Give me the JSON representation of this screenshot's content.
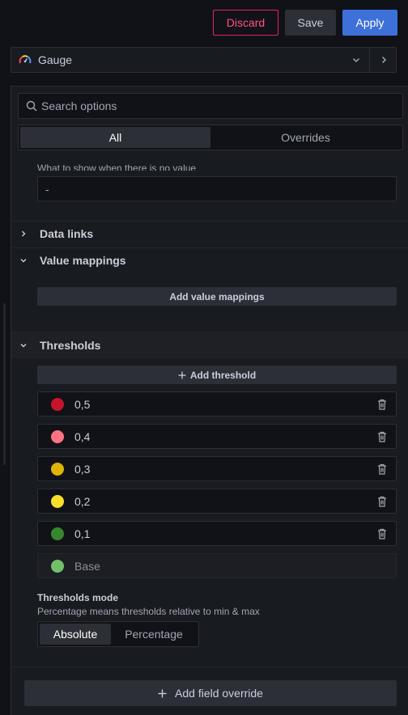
{
  "actions": {
    "discard_label": "Discard",
    "save_label": "Save",
    "apply_label": "Apply"
  },
  "visualization": {
    "name": "Gauge",
    "icon": "gauge-icon"
  },
  "search": {
    "placeholder": "Search options"
  },
  "option_tabs": {
    "all_label": "All",
    "overrides_label": "Overrides",
    "selected": "All"
  },
  "no_value": {
    "description": "What to show when there is no value",
    "placeholder": "-"
  },
  "sections": {
    "data_links": "Data links",
    "value_mappings": "Value mappings",
    "thresholds": "Thresholds"
  },
  "value_mappings": {
    "add_label": "Add value mappings"
  },
  "thresholds": {
    "add_label": "Add threshold",
    "items": [
      {
        "value": "0,5",
        "color": "#c4162a"
      },
      {
        "value": "0,4",
        "color": "#ff7383"
      },
      {
        "value": "0,3",
        "color": "#e0b400"
      },
      {
        "value": "0,2",
        "color": "#fade2a"
      },
      {
        "value": "0,1",
        "color": "#37872d"
      }
    ],
    "base": {
      "label": "Base",
      "color": "#73bf69"
    },
    "mode_title": "Thresholds mode",
    "mode_description": "Percentage means thresholds relative to min & max",
    "mode_absolute": "Absolute",
    "mode_percentage": "Percentage",
    "mode_selected": "Absolute"
  },
  "overrides": {
    "add_label": "Add field override"
  },
  "colors": {
    "background": "#111217",
    "panel": "#181b1f",
    "primary": "#3d71d9",
    "destructive": "#e0226e"
  }
}
